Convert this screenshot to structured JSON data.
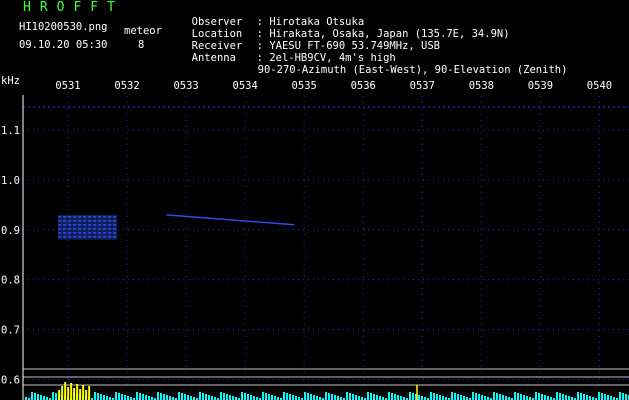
{
  "header": {
    "app_title": "HROFFT",
    "file_name": "HI10200530.png",
    "datetime": "09.10.20 05:30",
    "meteor_label": "meteor",
    "meteor_count": "8"
  },
  "station_info": [
    {
      "label": "Observer",
      "value": "Hirotaka Otsuka"
    },
    {
      "label": "Location",
      "value": "Hirakata, Osaka, Japan (135.7E, 34.9N)"
    },
    {
      "label": "Receiver",
      "value": "YAESU FT-690 53.749MHz, USB"
    },
    {
      "label": "Antenna",
      "value": "2el-HB9CV, 4m's high"
    },
    {
      "label": "",
      "value": "90-270-Azimuth (East-West), 90-Elevation (Zenith)"
    }
  ],
  "chart_data": {
    "type": "heatmap",
    "ylabel": "kHz",
    "x_ticks": [
      "0531",
      "0532",
      "0533",
      "0534",
      "0535",
      "0536",
      "0537",
      "0538",
      "0539",
      "0540"
    ],
    "y_ticks": [
      "1.1",
      "1.0",
      "0.9",
      "0.8",
      "0.7",
      "0.6"
    ],
    "ylim": [
      0.58,
      1.15
    ],
    "grid": true,
    "colors": {
      "background": "#000000",
      "grid": "#2233cc",
      "signal": "#3355ff",
      "spectrum": "#00ffff",
      "peak": "#ffff00"
    },
    "signals": [
      {
        "t_start": "05:30:50",
        "t_end": "05:31:50",
        "f_low": 0.88,
        "f_high": 0.93,
        "kind": "burst"
      },
      {
        "t_start": "05:32:40",
        "t_end": "05:34:50",
        "f_start": 0.93,
        "f_end": 0.91,
        "kind": "trail"
      }
    ]
  }
}
